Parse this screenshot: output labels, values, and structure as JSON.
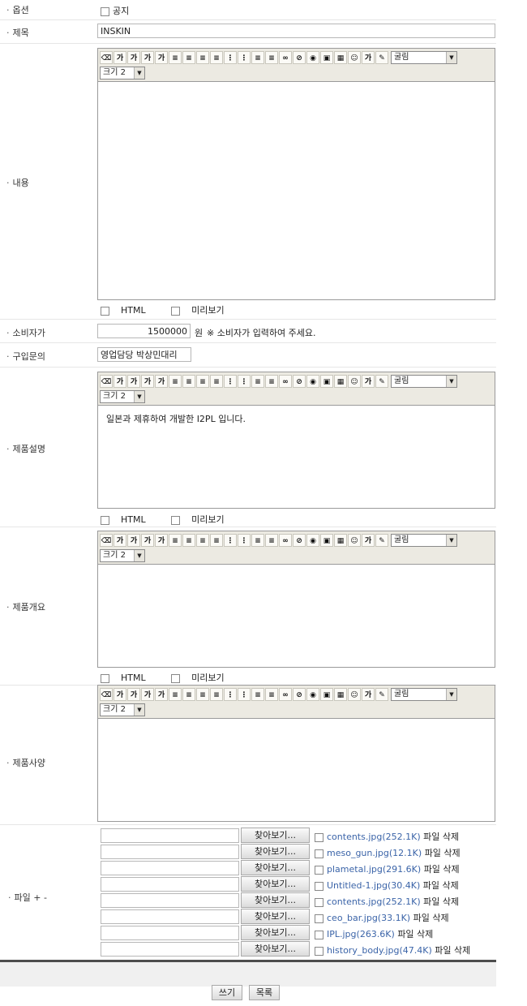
{
  "labels": {
    "option": "옵션",
    "title": "제목",
    "content": "내용",
    "consumer_price": "소비자가",
    "purchase_inquiry": "구입문의",
    "product_desc": "제품설명",
    "product_overview": "제품개요",
    "product_spec": "제품사양",
    "file": "파일 + -"
  },
  "option_notice": "공지",
  "title_value": "INSKIN",
  "editor": {
    "font_label": "굴림",
    "size_label": "크기 2",
    "html_label": "HTML",
    "preview_label": "미리보기",
    "toolbar_glyphs": [
      "⌫",
      "가",
      "가",
      "가",
      "가",
      "≡",
      "≡",
      "≡",
      "≡",
      "⋮",
      "⋮",
      "≡",
      "≡",
      "∞",
      "⊘",
      "◉",
      "▣",
      "▦",
      "☺",
      "가",
      "✎"
    ]
  },
  "product_desc_text": "일본과 제휴하여 개발한 I2PL 입니다.",
  "consumer_price": {
    "value": "1500000",
    "unit": "원",
    "note": "※ 소비자가 입력하여 주세요."
  },
  "purchase_inquiry_value": "영업담당 박상민대리",
  "files": {
    "browse_label": "찾아보기...",
    "delete_label": "파일 삭제",
    "items": [
      {
        "name": "contents.jpg(252.1K)"
      },
      {
        "name": "meso_gun.jpg(12.1K)"
      },
      {
        "name": "plametal.jpg(291.6K)"
      },
      {
        "name": "Untitled-1.jpg(30.4K)"
      },
      {
        "name": "contents.jpg(252.1K)"
      },
      {
        "name": "ceo_bar.jpg(33.1K)"
      },
      {
        "name": "IPL.jpg(263.6K)"
      },
      {
        "name": "history_body.jpg(47.4K)"
      }
    ]
  },
  "buttons": {
    "write": "쓰기",
    "list": "목록"
  }
}
